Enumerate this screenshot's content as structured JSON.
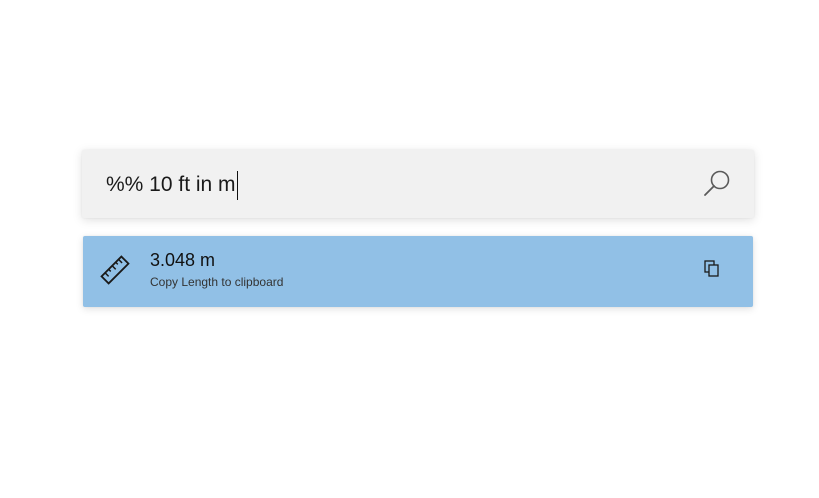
{
  "search": {
    "query": "%% 10 ft in m",
    "icon": "search-icon"
  },
  "result": {
    "title": "3.048 m",
    "subtitle": "Copy Length to clipboard",
    "icon": "ruler-icon",
    "action_icon": "copy-icon",
    "highlight_color": "#91c0e6"
  }
}
